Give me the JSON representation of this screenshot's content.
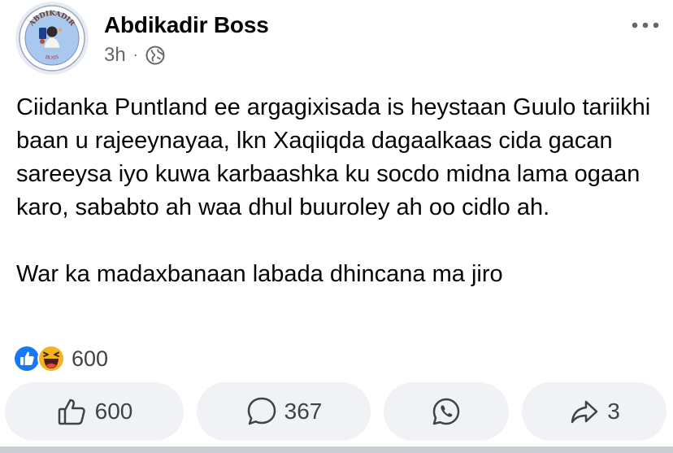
{
  "post": {
    "author": "Abdikadir Boss",
    "time": "3h",
    "separator": "·",
    "avatar_text_top": "ABDIKADIR",
    "avatar_text_bottom": "BOSS",
    "text_paragraph_1": "Ciidanka Puntland ee argagixisada is heystaan Guulo tariikhi baan u rajeeynayaa, lkn Xaqiiqda dagaalkaas cida gacan sareeysa iyo kuwa karbaashka ku socdo midna lama ogaan karo, sababto ah waa dhul buuroley ah oo cidlo ah.",
    "text_paragraph_2": "War ka madaxbanaan labada dhincana ma jiro"
  },
  "reactions": {
    "icons": [
      "like-reaction-icon",
      "haha-reaction-icon"
    ],
    "count": "600"
  },
  "actions": {
    "like_count": "600",
    "comment_count": "367",
    "share_count": "3"
  },
  "icons": {
    "globe": "globe-icon",
    "more": "more-options-icon",
    "like": "thumbs-up-icon",
    "comment": "comment-bubble-icon",
    "whatsapp": "whatsapp-icon",
    "share": "share-arrow-icon"
  },
  "colors": {
    "facebook_blue": "#1877f2",
    "haha_yellow": "#f7b125",
    "button_bg": "#f0f2f5",
    "secondary_text": "#65676b"
  }
}
